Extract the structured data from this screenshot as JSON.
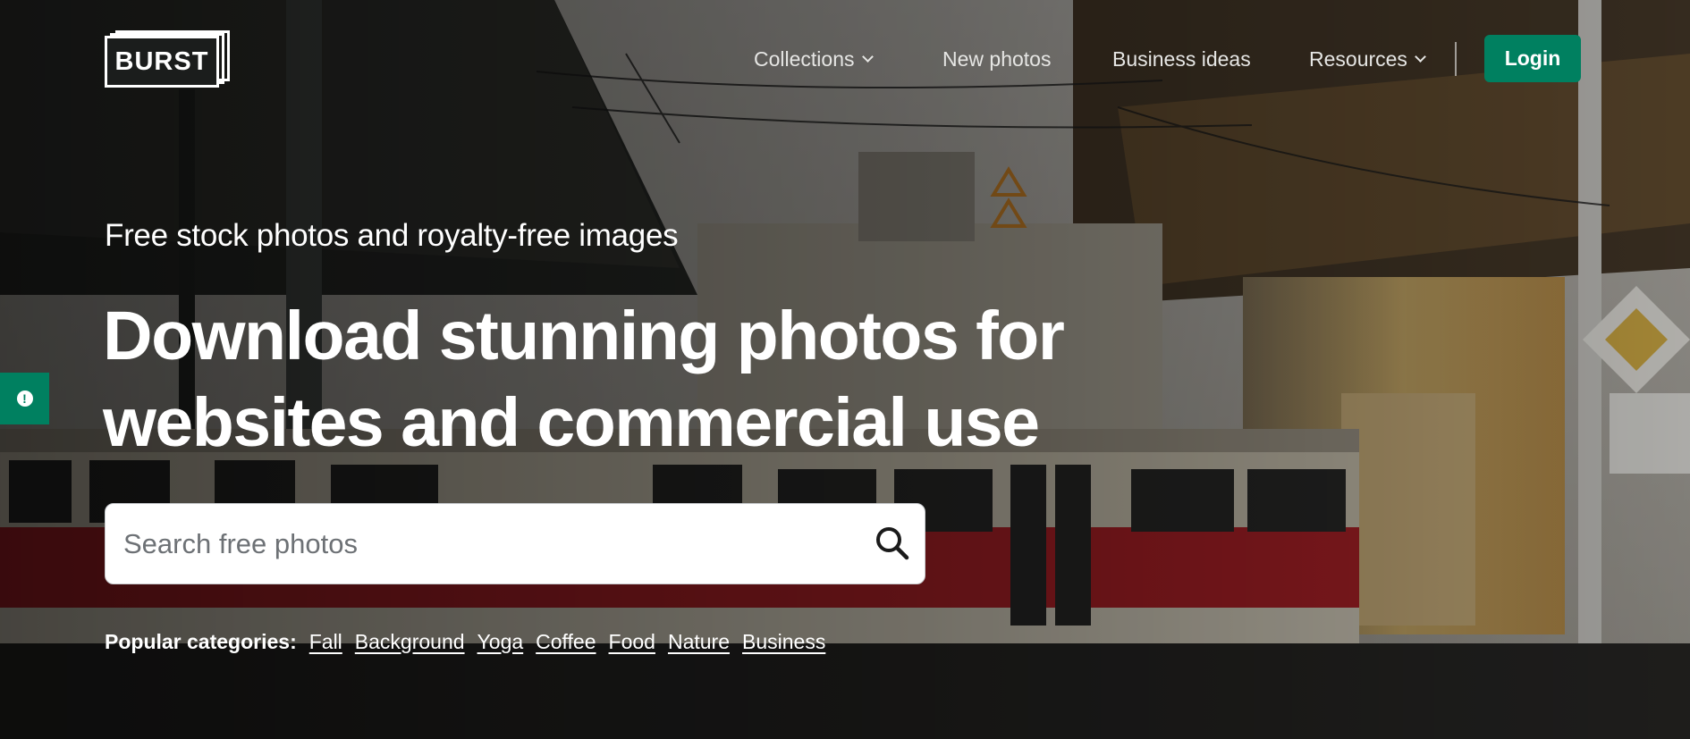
{
  "brand": {
    "logo_text": "BURST"
  },
  "nav": {
    "items": [
      {
        "label": "Collections",
        "has_dropdown": true
      },
      {
        "label": "New photos",
        "has_dropdown": false
      },
      {
        "label": "Business ideas",
        "has_dropdown": false
      },
      {
        "label": "Resources",
        "has_dropdown": true
      }
    ],
    "login_label": "Login"
  },
  "hero": {
    "subtitle": "Free stock photos and royalty-free images",
    "headline_line1": "Download stunning photos for",
    "headline_line2": "websites and commercial use"
  },
  "search": {
    "placeholder": "Search free photos",
    "value": "",
    "icon": "search-icon"
  },
  "popular": {
    "label": "Popular categories:",
    "categories": [
      "Fall",
      "Background",
      "Yoga",
      "Coffee",
      "Food",
      "Nature",
      "Business"
    ]
  },
  "feedback": {
    "icon": "exclamation-icon"
  },
  "colors": {
    "accent": "#008060",
    "text_on_dark": "#ffffff",
    "tram_red": "#b8232a",
    "tram_cream": "#e8e0cc"
  }
}
